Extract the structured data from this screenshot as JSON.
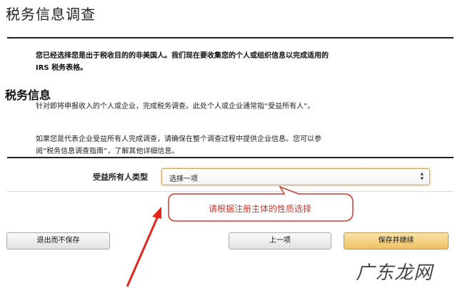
{
  "page": {
    "title": "税务信息调查"
  },
  "intro": {
    "text": "您已经选择您是出于税收目的的非美国人。我们现在要收集您的个人或组织信息以完成适用的 IRS 税务表格。"
  },
  "section": {
    "heading": "税务信息",
    "paragraph1": "针对即将申报收入的个人或企业，完成税务调查。此处个人或企业通常指“受益所有人”。",
    "paragraph2": "如果您是代表企业受益所有人完成调查，请确保在整个调查过程中提供企业信息。您可以参阅“税务信息调查指南”，了解其他详细信息。"
  },
  "form": {
    "beneficial_owner_type": {
      "label": "受益所有人类型",
      "selected": "选择一项"
    }
  },
  "annotation": {
    "callout_text": "请根据注册主体的性质选择",
    "color": "#d03a2f"
  },
  "buttons": {
    "exit": "退出而不保存",
    "prev": "上一项",
    "save": "保存并继续"
  },
  "watermark": {
    "text": "广东龙网"
  }
}
